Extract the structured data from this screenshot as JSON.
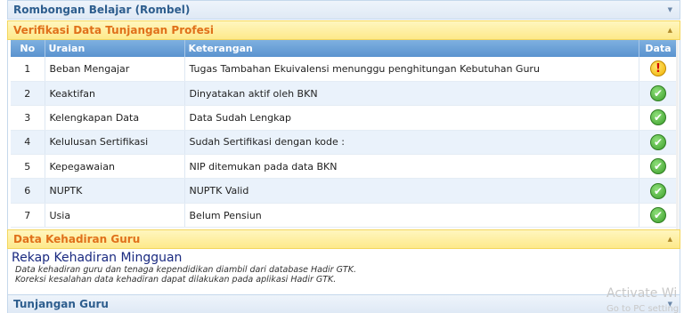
{
  "panels": {
    "rombel": "Rombongan Belajar (Rombel)",
    "verifikasi": "Verifikasi Data Tunjangan Profesi",
    "kehadiran": "Data Kehadiran Guru",
    "tunjangan": "Tunjangan Guru"
  },
  "table": {
    "headers": {
      "no": "No",
      "uraian": "Uraian",
      "keterangan": "Keterangan",
      "data": "Data"
    },
    "rows": [
      {
        "no": "1",
        "uraian": "Beban Mengajar",
        "keterangan": "Tugas Tambahan Ekuivalensi menunggu penghitungan Kebutuhan Guru",
        "status": "!"
      },
      {
        "no": "2",
        "uraian": "Keaktifan",
        "keterangan": "Dinyatakan aktif oleh BKN",
        "status": "✔"
      },
      {
        "no": "3",
        "uraian": "Kelengkapan Data",
        "keterangan": "Data Sudah Lengkap",
        "status": "✔"
      },
      {
        "no": "4",
        "uraian": "Kelulusan Sertifikasi",
        "keterangan": "Sudah Sertifikasi dengan kode :",
        "status": "✔"
      },
      {
        "no": "5",
        "uraian": "Kepegawaian",
        "keterangan": "NIP ditemukan pada data BKN",
        "status": "✔"
      },
      {
        "no": "6",
        "uraian": "NUPTK",
        "keterangan": "NUPTK Valid",
        "status": "✔"
      },
      {
        "no": "7",
        "uraian": "Usia",
        "keterangan": "Belum Pensiun",
        "status": "✔"
      }
    ]
  },
  "kehadiran": {
    "title": "Rekap Kehadiran Mingguan",
    "note1": "Data kehadiran guru dan tenaga kependidikan diambil dari database Hadir GTK.",
    "note2": "Koreksi kesalahan data kehadiran dapat dilakukan pada aplikasi Hadir GTK."
  },
  "watermark": {
    "line1": "Activate Wi",
    "line2": "Go to PC setting"
  },
  "icons": {
    "collapse": "chevron-down-icon",
    "expand": "chevron-up-icon",
    "ok": "check-circle-icon",
    "warn": "exclamation-circle-icon"
  },
  "colors": {
    "accent_orange": "#e0701a",
    "header_blue": "#5a93cf",
    "ok_green": "#3a9d2a",
    "warn_yellow": "#f1b000"
  }
}
